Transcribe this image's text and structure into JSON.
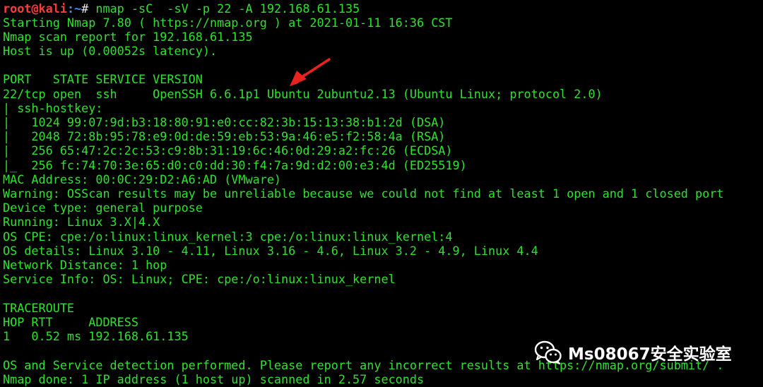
{
  "prompt": {
    "user_host": "root@kali",
    "path": ":~",
    "symbol": "# ",
    "command": "nmap -sC  -sV -p 22 -A 192.168.61.135"
  },
  "output_lines": [
    "Starting Nmap 7.80 ( https://nmap.org ) at 2021-01-11 16:36 CST",
    "Nmap scan report for 192.168.61.135",
    "Host is up (0.00052s latency).",
    "",
    "PORT   STATE SERVICE VERSION",
    "22/tcp open  ssh     OpenSSH 6.6.1p1 Ubuntu 2ubuntu2.13 (Ubuntu Linux; protocol 2.0)",
    "| ssh-hostkey: ",
    "|   1024 99:07:9d:b3:18:80:91:e0:cc:82:3b:15:13:38:b1:2d (DSA)",
    "|   2048 72:8b:95:78:e9:0d:de:59:eb:53:9a:46:e5:f2:58:4a (RSA)",
    "|   256 65:47:2c:2c:53:c9:8b:31:19:6c:46:0d:29:a2:fc:26 (ECDSA)",
    "|_  256 fc:74:70:3e:65:d0:c0:dd:30:f4:7a:9d:d2:00:e3:4d (ED25519)",
    "MAC Address: 00:0C:29:D2:A6:AD (VMware)",
    "Warning: OSScan results may be unreliable because we could not find at least 1 open and 1 closed port",
    "Device type: general purpose",
    "Running: Linux 3.X|4.X",
    "OS CPE: cpe:/o:linux:linux_kernel:3 cpe:/o:linux:linux_kernel:4",
    "OS details: Linux 3.10 - 4.11, Linux 3.16 - 4.6, Linux 3.2 - 4.9, Linux 4.4",
    "Network Distance: 1 hop",
    "Service Info: OS: Linux; CPE: cpe:/o:linux:linux_kernel",
    "",
    "TRACEROUTE",
    "HOP RTT     ADDRESS",
    "1   0.52 ms 192.168.61.135",
    "",
    "OS and Service detection performed. Please report any incorrect results at https://nmap.org/submit/ .",
    "Nmap done: 1 IP address (1 host up) scanned in 2.57 seconds"
  ],
  "watermark": {
    "text": "Ms08067安全实验室",
    "icon": "wechat-icon"
  },
  "annotation": {
    "icon": "red-arrow-icon",
    "color": "#e8231e"
  },
  "colors": {
    "background": "#000000",
    "text": "#2fe12f",
    "prompt_user": "#ff3b3b",
    "prompt_path": "#3b8eff"
  }
}
